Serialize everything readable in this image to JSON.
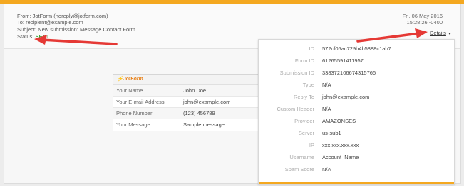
{
  "header": {
    "from": "From: JotForm (noreply@jotform.com)",
    "to": "To: recipient@example.com",
    "subject": "Subject: New submission: Message Contact Form",
    "status_label": "Status:",
    "status_value": "SENT",
    "date": "Fri, 06 May 2016",
    "time": "15:28:26 -0400",
    "details_label": "Details"
  },
  "form": {
    "logo": "JotForm",
    "rows": [
      {
        "label": "Your Name",
        "value": "John Doe"
      },
      {
        "label": "Your E-mail Address",
        "value": "john@example.com"
      },
      {
        "label": "Phone Number",
        "value": "(123) 456789"
      },
      {
        "label": "Your Message",
        "value": "Sample message"
      }
    ]
  },
  "details": [
    {
      "key": "ID",
      "value": "572cf05ac729b4b5888c1ab7"
    },
    {
      "key": "Form ID",
      "value": "61265591411957"
    },
    {
      "key": "Submission ID",
      "value": "338372106674315766"
    },
    {
      "key": "Type",
      "value": "N/A"
    },
    {
      "key": "Reply To",
      "value": "john@example.com"
    },
    {
      "key": "Custom Header",
      "value": "N/A"
    },
    {
      "key": "Provider",
      "value": "AMAZONSES"
    },
    {
      "key": "Server",
      "value": "us-sub1"
    },
    {
      "key": "IP",
      "value": "xxx.xxx.xxx.xxx"
    },
    {
      "key": "Username",
      "value": "Account_Name"
    },
    {
      "key": "Spam Score",
      "value": "N/A"
    }
  ],
  "colors": {
    "accent": "#f4a820",
    "sent": "#3aa63a",
    "arrow": "#e53935"
  }
}
